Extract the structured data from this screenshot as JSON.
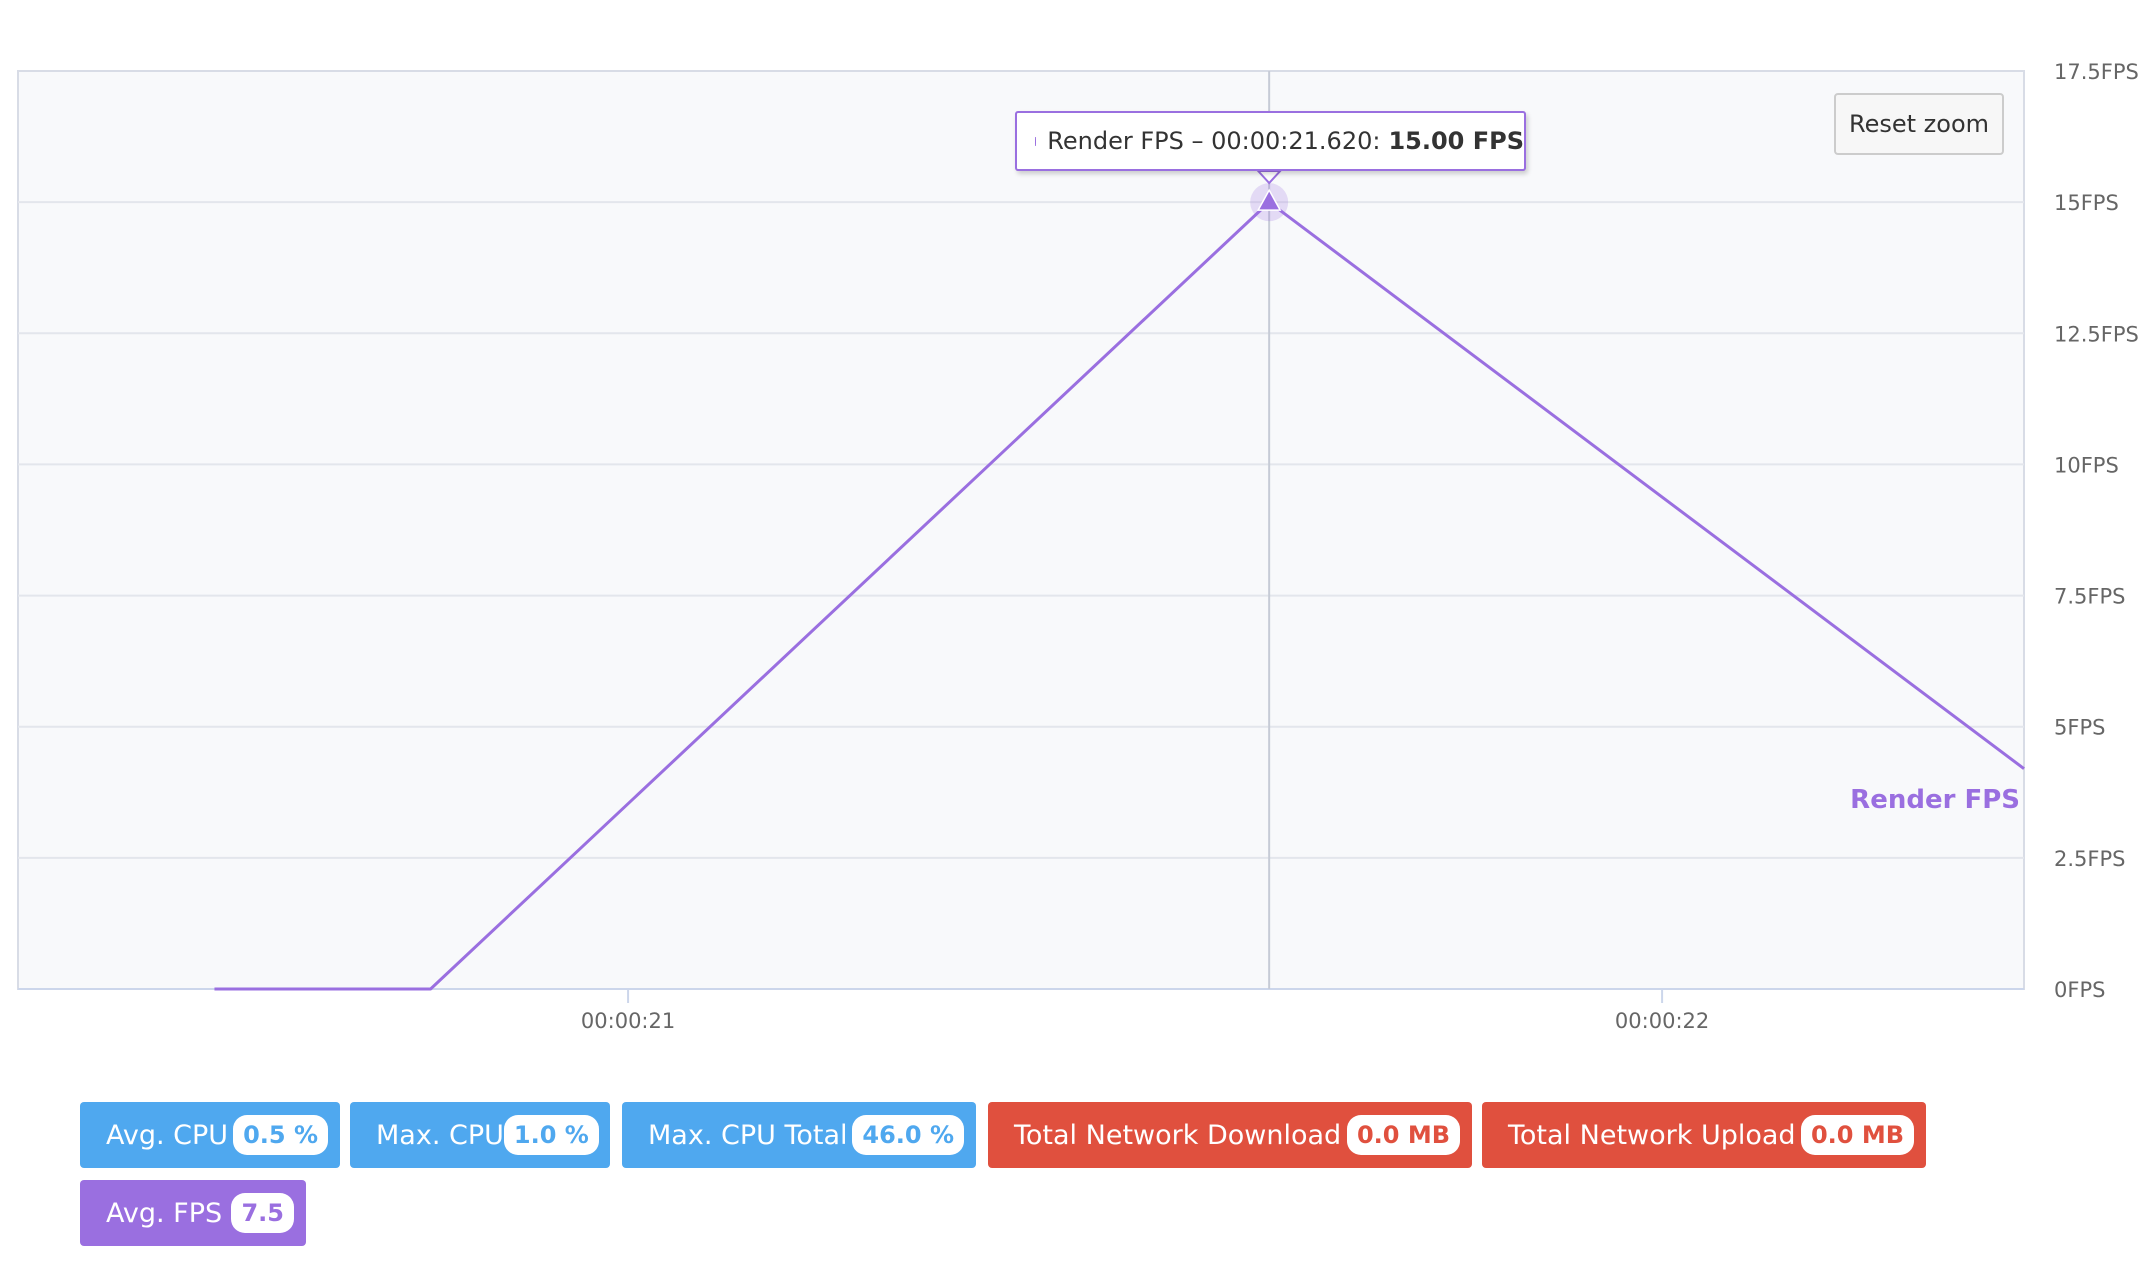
{
  "chart_data": {
    "type": "line",
    "series": [
      {
        "name": "Render FPS",
        "color": "#9a6fe0",
        "x": [
          "00:00:20.600",
          "00:00:20.809",
          "00:00:21.620",
          "00:00:22.350"
        ],
        "values": [
          0,
          0,
          15,
          4.2
        ]
      }
    ],
    "x_ticks": [
      "00:00:21",
      "00:00:22"
    ],
    "y_ticks": [
      "0FPS",
      "2.5FPS",
      "5FPS",
      "7.5FPS",
      "10FPS",
      "12.5FPS",
      "15FPS",
      "17.5FPS"
    ],
    "ylim": [
      0,
      17.5
    ],
    "grid": true,
    "series_label": "Render FPS",
    "tooltip": {
      "series": "Render FPS",
      "time": "00:00:21.620",
      "value": "15.00 FPS"
    }
  },
  "controls": {
    "reset_zoom": "Reset zoom"
  },
  "badges": [
    {
      "label": "Avg. CPU",
      "value": "0.5 %",
      "color": "#4fa8ef"
    },
    {
      "label": "Max. CPU",
      "value": "1.0 %",
      "color": "#4fa8ef"
    },
    {
      "label": "Max. CPU Total",
      "value": "46.0 %",
      "color": "#4fa8ef"
    },
    {
      "label": "Total Network Download",
      "value": "0.0 MB",
      "color": "#e0503e"
    },
    {
      "label": "Total Network Upload",
      "value": "0.0 MB",
      "color": "#e0503e"
    },
    {
      "label": "Avg. FPS",
      "value": "7.5",
      "color": "#9a6fe0"
    }
  ]
}
